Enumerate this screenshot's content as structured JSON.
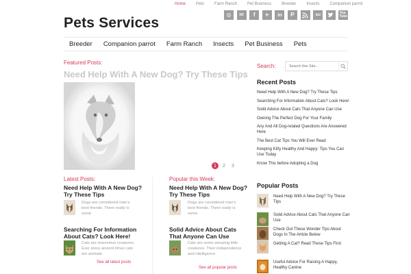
{
  "top_nav": [
    "Home",
    "Pets",
    "Farm Ranch",
    "Pet Business",
    "Breeder",
    "Insects",
    "Companion parrot"
  ],
  "social_icons": [
    "dribbble-icon",
    "mail-icon",
    "facebook-icon",
    "plus-icon",
    "linkedin-icon",
    "pinterest-icon",
    "rss-icon",
    "stumbleupon-icon",
    "twitter-icon",
    "youtube-icon"
  ],
  "site": {
    "title": "Pets Services"
  },
  "main_nav": [
    "Breeder",
    "Companion parrot",
    "Farm Ranch",
    "Insects",
    "Pet Business",
    "Pets"
  ],
  "featured": {
    "label": "Featured Posts:",
    "title": "Need Help With A New Dog? Try These Tips",
    "pages": [
      "1",
      "2",
      "3"
    ]
  },
  "latest": {
    "heading": "Latest Posts:",
    "posts": [
      {
        "title": "Need Help With A New Dog? Try These Tips",
        "excerpt": "Dogs are considered man's best friends. There really is some"
      },
      {
        "title": "Searching For Information About Cats? Look Here!",
        "excerpt": "Cats are marvelous creatures. Ever since ancient times cats are animals"
      }
    ],
    "more": "See all latest posts"
  },
  "popular_week": {
    "heading": "Popular this Week:",
    "posts": [
      {
        "title": "Need Help With A New Dog? Try These Tips",
        "excerpt": "Dogs are considered man's best friends. There really is some"
      },
      {
        "title": "Solid Advice About Cats That Anyone Can Use",
        "excerpt": "Cats are some amazing little creatures. Their independence and intelligence"
      }
    ],
    "more": "See all popular posts"
  },
  "search": {
    "label": "Search:",
    "placeholder": "Search this Site..."
  },
  "recent_posts": {
    "heading": "Recent Posts",
    "items": [
      "Need Help With A New Dog? Try These Tips",
      "Searching For Information About Cats? Look Here!",
      "Solid Advice About Cats That Anyone Can Use",
      "Owning The Perfect Dog For Your Family",
      "Any And All Dog-related Questions Are Answered Here",
      "The Best Cat Tips You Will Ever Read",
      "Keeping Kitty Healthy And Happy: Tips You Can Use Today",
      "Know This before Adopting a Dog"
    ]
  },
  "popular_posts": {
    "heading": "Popular Posts",
    "items": [
      "Need Help With A New Dog? Try These Tips",
      "Solid Advice About Cats That Anyone Can Use",
      "Check Out These Wonder Tips About Dogs In The Article Below",
      "Getting A Cat? Read These Tips First",
      "Useful Advice For Raising A Happy, Healthy Canine"
    ]
  },
  "colors": {
    "accent": "#d43b5a",
    "icon_gray": "#9e9e9e",
    "text": "#222222",
    "muted": "#999999"
  }
}
